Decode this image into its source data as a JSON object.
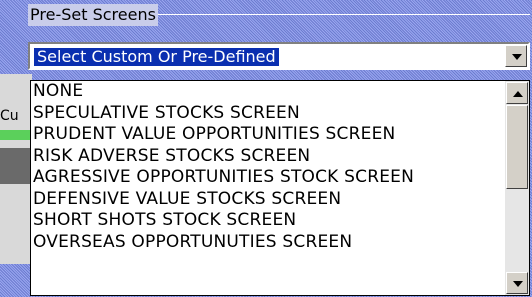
{
  "groupbox": {
    "label": "Pre-Set Screens"
  },
  "combo": {
    "selected": "Select Custom Or Pre-Defined"
  },
  "background_fragment": "Cu",
  "dropdown": {
    "items": [
      "NONE",
      "SPECULATIVE STOCKS SCREEN",
      "PRUDENT VALUE OPPORTUNITIES SCREEN",
      "RISK ADVERSE STOCKS SCREEN",
      "AGRESSIVE OPPORTUNITIES STOCK SCREEN",
      "DEFENSIVE VALUE STOCKS SCREEN",
      "SHORT SHOTS STOCK SCREEN",
      "OVERSEAS OPPORTUNUTIES SCREEN"
    ]
  },
  "colors": {
    "selection": "#0a2fb0",
    "background_pattern": "#7f8fe0"
  },
  "icons": [
    "chevron-down-icon",
    "scroll-up-icon",
    "scroll-down-icon"
  ]
}
